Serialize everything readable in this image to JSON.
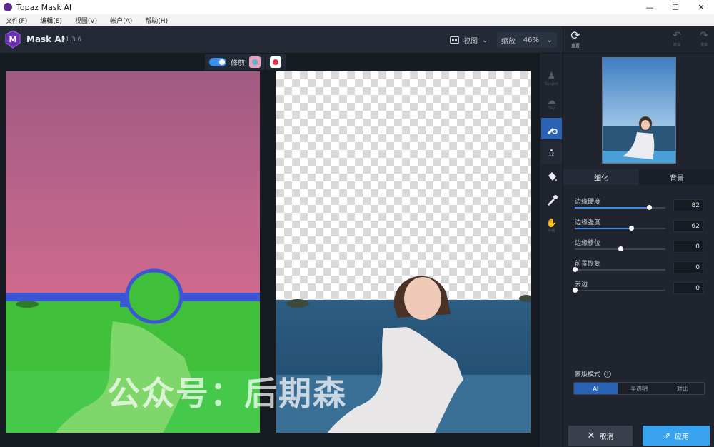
{
  "window": {
    "title": "Topaz Mask AI",
    "minimize": "—",
    "maximize": "☐",
    "close": "✕"
  },
  "menu": [
    {
      "label": "文件(F)"
    },
    {
      "label": "编辑(E)"
    },
    {
      "label": "视图(V)"
    },
    {
      "label": "帐户(A)"
    },
    {
      "label": "帮助(H)"
    }
  ],
  "header": {
    "app_name": "Mask AI",
    "version": "v1.3.6",
    "view_label": "视图",
    "zoom_label": "缩放",
    "zoom_value": "46%"
  },
  "canvas_toolbar": {
    "trim_label": "修剪"
  },
  "watermark": "公众号：后期森",
  "tools": [
    {
      "name": "subject-tool",
      "label": "Subject"
    },
    {
      "name": "sky-tool",
      "label": "Sky"
    },
    {
      "name": "brush-tool",
      "label": ""
    },
    {
      "name": "brush-size",
      "label": "12"
    },
    {
      "name": "fill-tool",
      "label": ""
    },
    {
      "name": "eyedropper-tool",
      "label": ""
    },
    {
      "name": "pan-tool",
      "label": "平移"
    }
  ],
  "right_panel": {
    "reset_label": "重置",
    "undo_label": "撤消",
    "redo_label": "重做",
    "tabs": [
      {
        "label": "细化"
      },
      {
        "label": "背景"
      }
    ],
    "sliders": [
      {
        "label": "边缘硬度",
        "value": "82",
        "level": 0.82
      },
      {
        "label": "边缘强度",
        "value": "62",
        "level": 0.62
      },
      {
        "label": "边缘移位",
        "value": "0",
        "level": 0.5
      },
      {
        "label": "前景恢复",
        "value": "0",
        "level": 0.0
      },
      {
        "label": "去边",
        "value": "0",
        "level": 0.0
      }
    ],
    "mask_mode_label": "蒙版模式",
    "mask_modes": [
      {
        "label": "AI"
      },
      {
        "label": "半透明"
      },
      {
        "label": "对比"
      }
    ],
    "cancel_label": "取消",
    "apply_label": "应用"
  },
  "colors": {
    "accent": "#3a8ee6",
    "apply": "#3aa3f0",
    "active_tool": "#2a63b4"
  }
}
